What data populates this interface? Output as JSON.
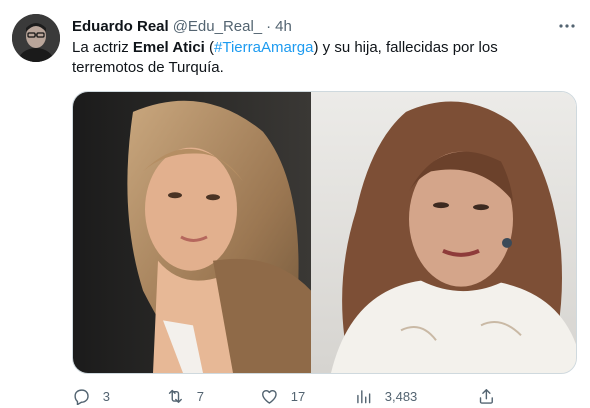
{
  "tweet": {
    "author_name": "Eduardo Real",
    "handle": "@Edu_Real_",
    "separator": "·",
    "time": "4h",
    "text": {
      "part1": "La actriz ",
      "bold_name": "Emel Atici",
      "open_paren": " (",
      "hashtag": "#TierraAmarga",
      "part2": ") y su hija, fallecidas por los terremotos de Turquía."
    },
    "stats": {
      "replies": "3",
      "retweets": "7",
      "likes": "17",
      "views": "3,483"
    }
  },
  "icons": {
    "more": "more-horizontal-icon",
    "reply": "reply-icon",
    "retweet": "retweet-icon",
    "like": "heart-icon",
    "views": "views-chart-icon",
    "share": "share-icon"
  },
  "colors": {
    "text": "#0f1419",
    "secondary": "#536471",
    "link": "#1d9bf0",
    "border": "#cfd9de"
  }
}
